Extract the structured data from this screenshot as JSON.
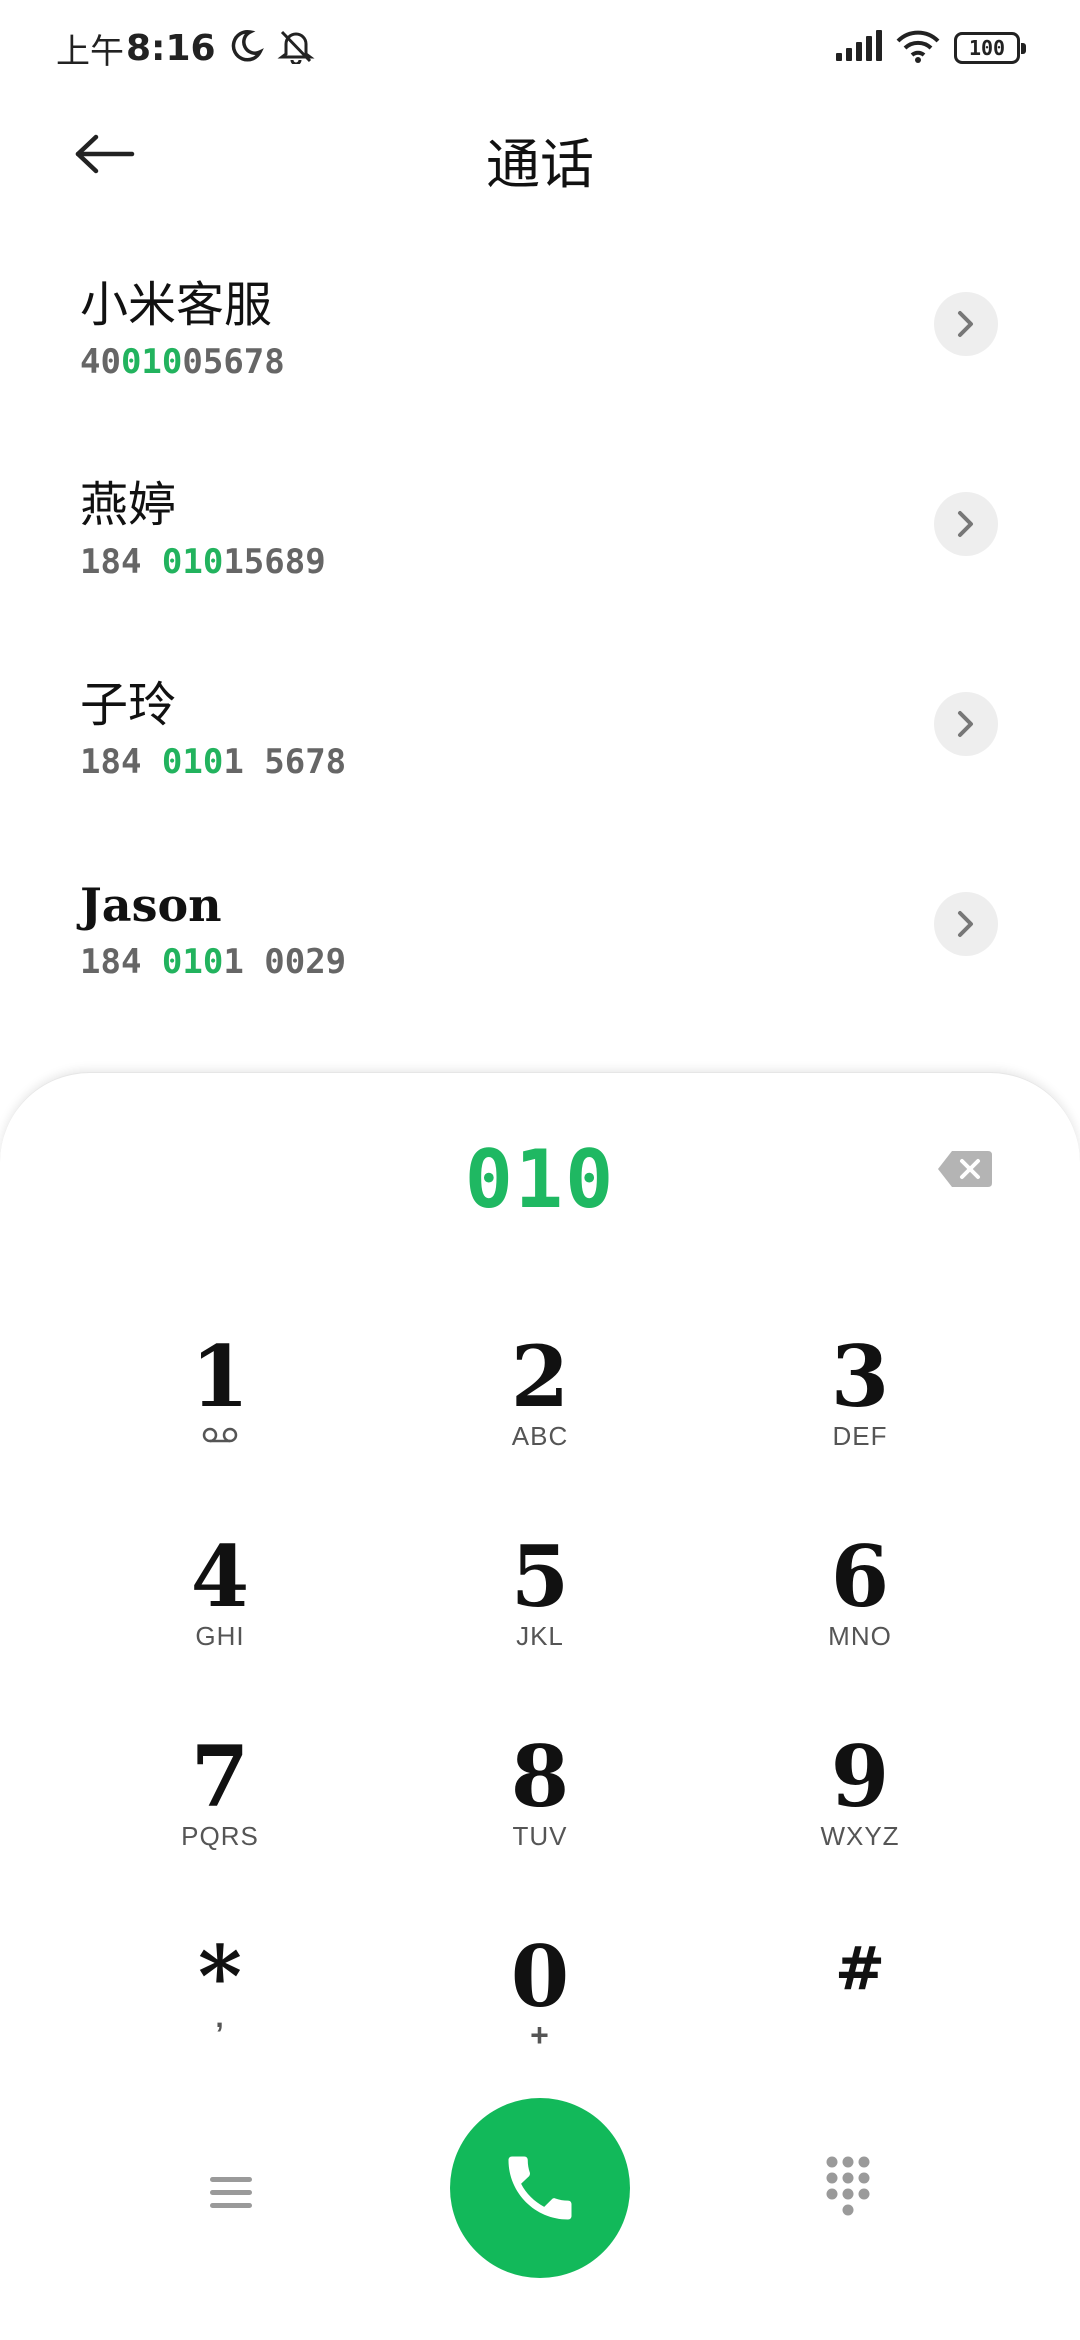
{
  "status_bar": {
    "time_prefix": "上午",
    "time": "8:16",
    "battery": "100",
    "icons": [
      "moon-icon",
      "bell-off-icon",
      "signal-icon",
      "wifi-icon",
      "battery-icon"
    ]
  },
  "header": {
    "title": "通话",
    "back_icon": "arrow-left-icon"
  },
  "contacts": [
    {
      "name": "小米客服",
      "number_parts": [
        "40",
        "010",
        "05678"
      ]
    },
    {
      "name": "燕婷",
      "number_parts": [
        "184 ",
        "010",
        "15689"
      ]
    },
    {
      "name": "子玲",
      "number_parts": [
        "184 ",
        "010",
        "1 5678"
      ]
    },
    {
      "name": "Jason",
      "number_parts": [
        "184 ",
        "010",
        "1 0029"
      ]
    }
  ],
  "dialer": {
    "dialed": "010",
    "backspace_icon": "backspace-icon",
    "accent_color": "#1fb862",
    "keys": [
      {
        "digit": "1",
        "letters": ""
      },
      {
        "digit": "2",
        "letters": "ABC"
      },
      {
        "digit": "3",
        "letters": "DEF"
      },
      {
        "digit": "4",
        "letters": "GHI"
      },
      {
        "digit": "5",
        "letters": "JKL"
      },
      {
        "digit": "6",
        "letters": "MNO"
      },
      {
        "digit": "7",
        "letters": "PQRS"
      },
      {
        "digit": "8",
        "letters": "TUV"
      },
      {
        "digit": "9",
        "letters": "WXYZ"
      },
      {
        "digit": "*",
        "letters": ","
      },
      {
        "digit": "0",
        "letters": "+"
      },
      {
        "digit": "#",
        "letters": ""
      }
    ]
  },
  "bottom_bar": {
    "menu_icon": "menu-icon",
    "call_icon": "phone-icon",
    "keypad_icon": "dialpad-icon",
    "call_color": "#12b95a"
  }
}
